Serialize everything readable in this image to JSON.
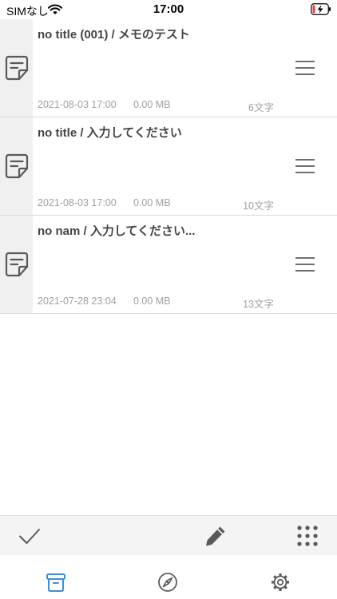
{
  "status_bar": {
    "carrier": "SIMなし",
    "time": "17:00",
    "wifi_icon": "wifi-icon",
    "battery_icon": "battery-charging-icon"
  },
  "memos": [
    {
      "title": "no title (001) / メモのテスト",
      "date": "2021-08-03 17:00",
      "size": "0.00 MB",
      "chars": "6文字"
    },
    {
      "title": "no title / 入力してください",
      "date": "2021-08-03 17:00",
      "size": "0.00 MB",
      "chars": "10文字"
    },
    {
      "title": "no nam / 入力してください...",
      "date": "2021-07-28 23:04",
      "size": "0.00 MB",
      "chars": "13文字"
    }
  ],
  "icons": {
    "memo": "memo-doc-icon",
    "row_menu": "hamburger-menu-icon",
    "check": "checkmark-icon",
    "edit": "pencil-icon",
    "grid": "grid-dots-icon",
    "tab_archive": "archive-box-icon",
    "tab_explore": "compass-icon",
    "tab_settings": "gear-icon"
  },
  "colors": {
    "active_tab": "#3b8fd9",
    "icon_gray": "#5a5a5a",
    "meta_text": "#a0a0a0",
    "thumb_bg": "#f0f0f0",
    "toolbar_bg": "#f4f4f4",
    "battery_red": "#e5463b"
  },
  "tabs": {
    "active": "archive"
  }
}
